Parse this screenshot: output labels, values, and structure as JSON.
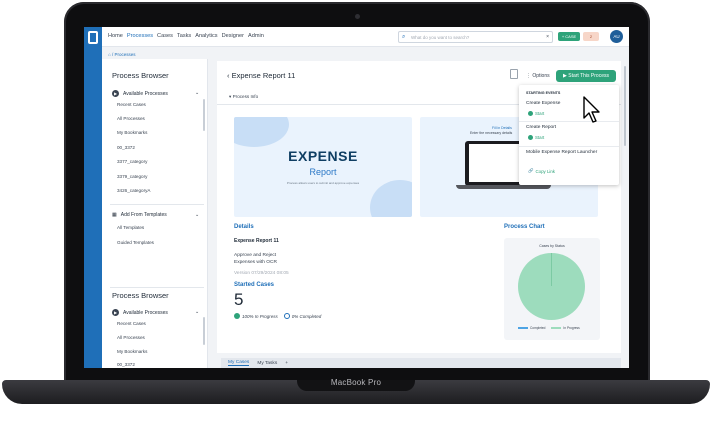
{
  "device": {
    "brand": "MacBook Pro"
  },
  "topbar": {
    "nav": [
      "Home",
      "Processes",
      "Cases",
      "Tasks",
      "Analytics",
      "Designer",
      "Admin"
    ],
    "active_nav": "Processes",
    "search_placeholder": "What do you want to search?",
    "search_clear": "×",
    "case_button": "+ CASE",
    "flag_badge": "2",
    "avatar_initials": "AU"
  },
  "breadcrumb": {
    "home_icon": "⌂",
    "sep": "/",
    "current": "Processes"
  },
  "sidebar": {
    "title": "Process Browser",
    "available_label": "Available Processes",
    "items": [
      "Recent Cases",
      "All Processes",
      "My Bookmarks",
      "00_3372",
      "3377_category",
      "3379_category",
      "3426_categoryA"
    ],
    "templates_label": "Add From Templates",
    "template_items": [
      "All Templates",
      "Guided Templates"
    ],
    "title2": "Process Browser",
    "available_label2": "Available Processes",
    "items2": [
      "Recent Cases",
      "All Processes",
      "My Bookmarks",
      "00_3372"
    ]
  },
  "main": {
    "back": "‹",
    "title": "Expense Report 11",
    "options_label": "Options",
    "start_button": "Start This Process",
    "process_info": "Process Info",
    "hero": {
      "big": "EXPENSE",
      "sub": "Report",
      "tiny": "Process allows users to submit and approve expenses"
    },
    "hero2": {
      "line1": "Fill in Details",
      "line2": "Enter the necessary details"
    },
    "details_title": "Details",
    "details_name": "Expense Report 11",
    "details_desc": "Approve and Reject Expenses with OCR",
    "version": "Version 07/29/2024 08:05",
    "started_title": "Started Cases",
    "started_count": "5",
    "in_progress": "100% In Progress",
    "completed": "0% Completed",
    "chart_title": "Process Chart",
    "chart_card_title": "Cases by Status",
    "legend_completed": "Completed",
    "legend_in_progress": "In Progress"
  },
  "tabs": [
    "My Cases",
    "My Tasks",
    "+"
  ],
  "dropdown": {
    "header": "STARTING EVENTS",
    "events": [
      {
        "name": "Create Expense",
        "action": "Start"
      },
      {
        "name": "Create Report",
        "action": "Start"
      },
      {
        "name": "Mobile Expense Report Launcher",
        "action": "Copy Link"
      }
    ]
  },
  "chart_data": {
    "type": "pie",
    "title": "Cases by Status",
    "categories": [
      "Completed",
      "In Progress"
    ],
    "values": [
      0,
      5
    ],
    "colors": [
      "#4ea4e4",
      "#9ddcbd"
    ]
  }
}
